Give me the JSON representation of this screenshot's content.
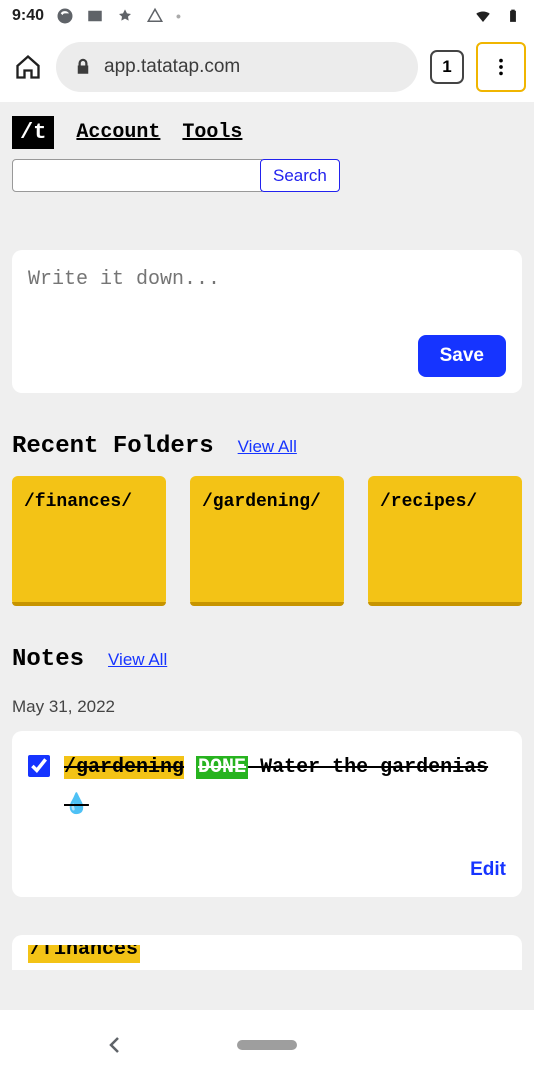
{
  "status": {
    "time": "9:40"
  },
  "browser": {
    "url": "app.tatatap.com",
    "tab_count": "1"
  },
  "site": {
    "logo": "/t",
    "nav": {
      "account": "Account",
      "tools": "Tools"
    },
    "search": {
      "placeholder": "",
      "button": "Search"
    },
    "compose": {
      "placeholder": "Write it down...",
      "save": "Save"
    },
    "recent_folders": {
      "title": "Recent Folders",
      "view_all": "View All",
      "items": [
        "/finances/",
        "/gardening/",
        "/recipes/"
      ]
    },
    "notes": {
      "title": "Notes",
      "view_all": "View All",
      "date": "May 31, 2022",
      "items": [
        {
          "checked": true,
          "tag": "/gardening",
          "status": "DONE",
          "text": " Water the gardenias",
          "emoji": "💧",
          "edit": "Edit"
        },
        {
          "tag": "/finances"
        }
      ]
    }
  }
}
